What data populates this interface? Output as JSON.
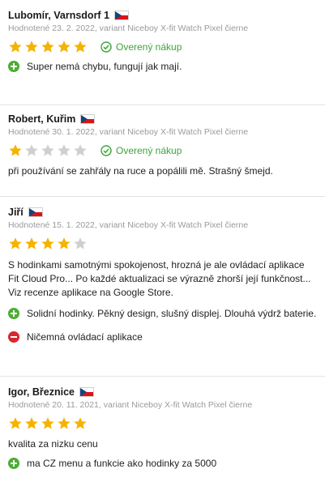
{
  "reviews": [
    {
      "author": "Lubomír, Varnsdorf 1",
      "meta": "Hodnotené 23. 2. 2022, variant Niceboy X-fit Watch Pixel čierne",
      "rating": 5,
      "verified": "Overený nákup",
      "pro": "Super nemá chybu, fungují jak mají."
    },
    {
      "author": "Robert, Kuřim",
      "meta": "Hodnotené 30. 1. 2022, variant Niceboy X-fit Watch Pixel čierne",
      "rating": 1,
      "verified": "Overený nákup",
      "text": "při používání se zahřály na ruce a popálili mě. Strašný šmejd."
    },
    {
      "author": "Jiří",
      "meta": "Hodnotené 15. 1. 2022, variant Niceboy X-fit Watch Pixel čierne",
      "rating": 4,
      "text_lines": [
        "S hodinkami samotnými spokojenost, hrozná je ale ovládací aplikace",
        "Fit Cloud Pro... Po každé aktualizaci se výrazně zhorší její funkčnost...",
        "Viz recenze aplikace na Google Store."
      ],
      "pro": "Solidní hodinky. Pěkný design, slušný displej. Dlouhá výdrž baterie.",
      "con": "Ničemná ovládací aplikace"
    },
    {
      "author": "Igor, Březnice",
      "meta": "Hodnotené 20. 11. 2021, variant Niceboy X-fit Watch Pixel čierne",
      "rating": 5,
      "text": "kvalita za nizku cenu",
      "pro": "ma CZ menu a funkcie ako hodinky za 5000"
    }
  ],
  "colors": {
    "star_filled": "#f5b301",
    "star_empty": "#cfcfcf",
    "verified_green": "#3aa53a",
    "pro_green": "#4cae33",
    "con_red": "#d9272e"
  },
  "icons": {
    "flag": "czech-flag-icon",
    "star": "star-icon",
    "verified": "check-circle-icon",
    "pro": "plus-circle-icon",
    "con": "minus-circle-icon"
  }
}
